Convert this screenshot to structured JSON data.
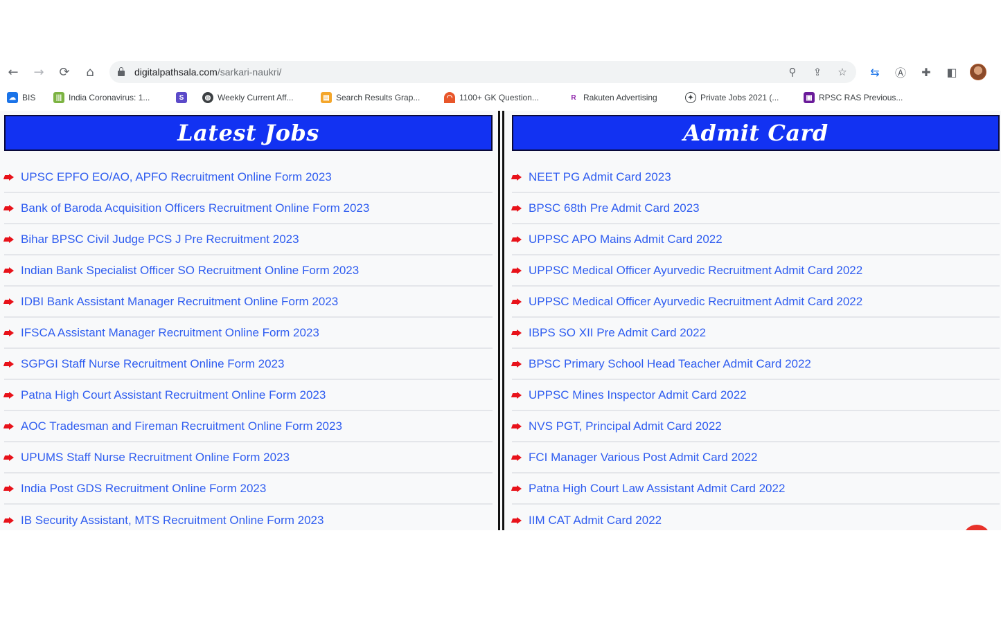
{
  "browser": {
    "url_host": "digitalpathsala.com",
    "url_path": "/sarkari-naukri/"
  },
  "bookmarks": [
    {
      "label": "BIS",
      "icon": "cloud-icon",
      "color": "#1a73e8"
    },
    {
      "label": "India Coronavirus: 1...",
      "icon": "iii-icon",
      "color": "#7cb342"
    },
    {
      "label": "",
      "icon": "sf-icon",
      "color": "#5b4ac9"
    },
    {
      "label": "Weekly Current Aff...",
      "icon": "globe-icon",
      "color": "#3c4043"
    },
    {
      "label": "Search Results Grap...",
      "icon": "doc-icon",
      "color": "#f4a62a"
    },
    {
      "label": "1100+ GK Question...",
      "icon": "rainbow-icon",
      "color": "#e8562a"
    },
    {
      "label": "Rakuten Advertising",
      "icon": "r-icon",
      "color": "#8e24aa"
    },
    {
      "label": "Private Jobs 2021 (...",
      "icon": "compass-icon",
      "color": "#3c4043"
    },
    {
      "label": "RPSC RAS Previous...",
      "icon": "book-icon",
      "color": "#6a1b9a"
    }
  ],
  "latest_jobs": {
    "title": "Latest Jobs",
    "items": [
      "UPSC EPFO EO/AO, APFO Recruitment Online Form 2023",
      "Bank of Baroda Acquisition Officers Recruitment Online Form 2023",
      "Bihar BPSC Civil Judge PCS J Pre Recruitment 2023",
      "Indian Bank Specialist Officer SO Recruitment Online Form 2023",
      "IDBI Bank Assistant Manager Recruitment Online Form 2023",
      "IFSCA Assistant Manager Recruitment Online Form 2023",
      "SGPGI Staff Nurse Recruitment Online Form 2023",
      "Patna High Court Assistant Recruitment Online Form 2023",
      "AOC Tradesman and Fireman Recruitment Online Form 2023",
      "UPUMS Staff Nurse Recruitment Online Form 2023",
      "India Post GDS Recruitment Online Form 2023",
      "IB Security Assistant, MTS Recruitment Online Form 2023"
    ]
  },
  "admit_card": {
    "title": "Admit Card",
    "items": [
      "NEET PG Admit Card 2023",
      "BPSC 68th Pre Admit Card 2023",
      "UPPSC APO Mains Admit Card 2022",
      "UPPSC Medical Officer Ayurvedic Recruitment Admit Card 2022",
      "UPPSC Medical Officer Ayurvedic Recruitment Admit Card 2022",
      "IBPS SO XII Pre Admit Card 2022",
      "BPSC Primary School Head Teacher Admit Card 2022",
      "UPPSC Mines Inspector Admit Card 2022",
      "NVS PGT, Principal Admit Card 2022",
      "FCI Manager Various Post Admit Card 2022",
      "Patna High Court Law Assistant Admit Card 2022",
      "IIM CAT Admit Card 2022"
    ]
  },
  "colors": {
    "header_blue": "#1232f2",
    "link_blue": "#2f5df0",
    "bullet_red": "#e8121a"
  }
}
